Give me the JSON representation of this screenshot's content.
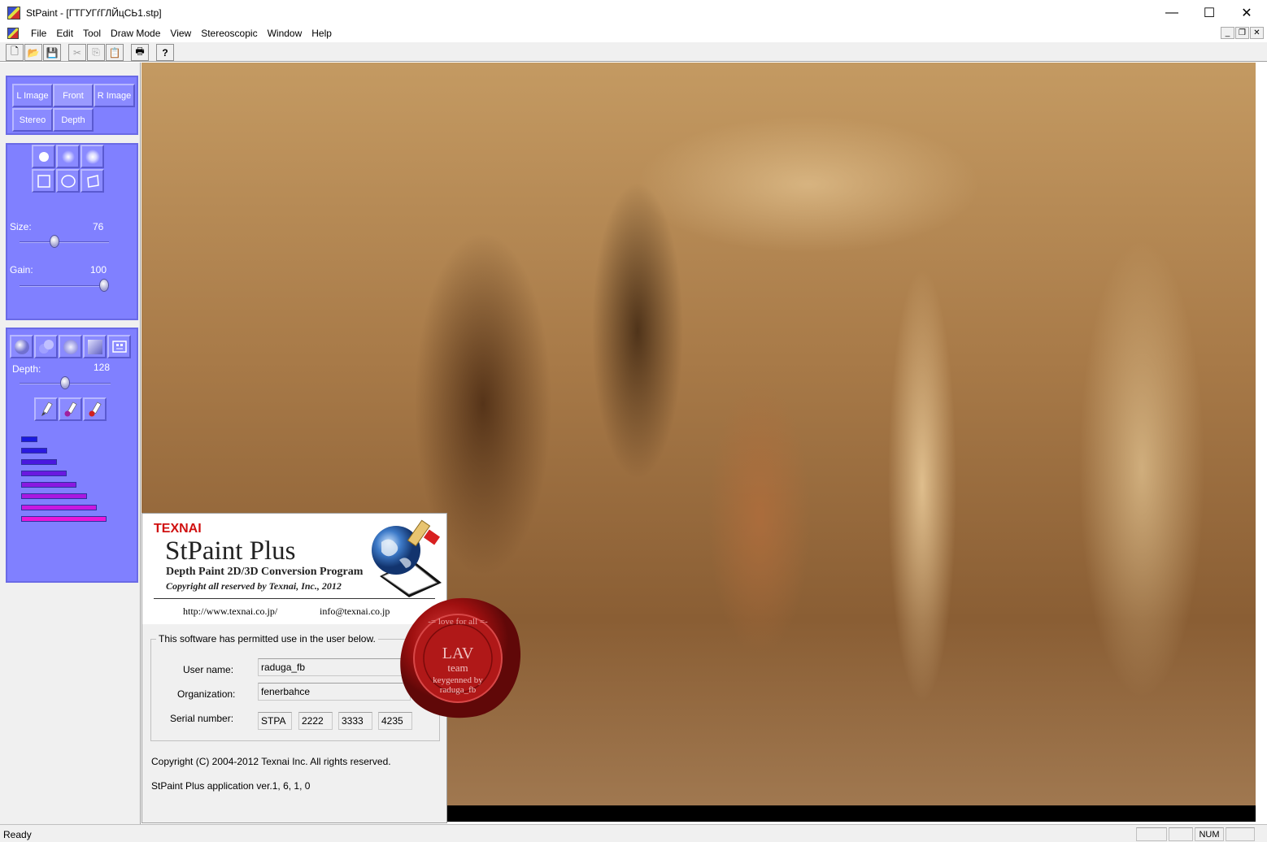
{
  "window": {
    "title": "StPaint - [ГТГУГѓГЛЙцСЬ1.stp]",
    "minimize": "—",
    "maximize": "☐",
    "close": "✕"
  },
  "menu": {
    "items": [
      "File",
      "Edit",
      "Tool",
      "Draw Mode",
      "View",
      "Stereoscopic",
      "Window",
      "Help"
    ],
    "mdi_minimize": "_",
    "mdi_restore": "❐",
    "mdi_close": "✕"
  },
  "toolbar": {
    "new": "🗋",
    "open": "📂",
    "save": "💾",
    "cut": "✂",
    "copy": "⎘",
    "paste": "📋",
    "print": "🖶",
    "help": "?"
  },
  "view_panel": {
    "buttons": [
      "L Image",
      "Front",
      "R Image",
      "Stereo",
      "Depth"
    ],
    "active": "Front"
  },
  "brush_panel": {
    "size_label": "Size:",
    "size_value": "76",
    "size_fraction": 0.38,
    "gain_label": "Gain:",
    "gain_value": "100",
    "gain_fraction": 1.0
  },
  "depth_panel": {
    "depth_label": "Depth:",
    "depth_value": "128",
    "depth_fraction": 0.5,
    "distribution_bars": [
      {
        "fraction": 0.16,
        "color": "#1a1ae0"
      },
      {
        "fraction": 0.26,
        "color": "#2a1ae0"
      },
      {
        "fraction": 0.36,
        "color": "#4a18e0"
      },
      {
        "fraction": 0.46,
        "color": "#6a18e0"
      },
      {
        "fraction": 0.56,
        "color": "#8a18e0"
      },
      {
        "fraction": 0.66,
        "color": "#a818e0"
      },
      {
        "fraction": 0.76,
        "color": "#c818e0"
      },
      {
        "fraction": 0.86,
        "color": "#e818d8"
      }
    ]
  },
  "about": {
    "brand": "TEXNAI",
    "product": "StPaint Plus",
    "subtitle": "Depth Paint 2D/3D Conversion Program",
    "copyright_line": "Copyright all reserved by Texnai, Inc., 2012",
    "url": "http://www.texnai.co.jp/",
    "email": "info@texnai.co.jp",
    "group_title": "This software has permitted use in the user below.",
    "user_label": "User name:",
    "user_value": "raduga_fb",
    "org_label": "Organization:",
    "org_value": "fenerbahce",
    "serial_label": "Serial number:",
    "serial": [
      "STPA",
      "2222",
      "3333",
      "4235"
    ],
    "footer_copyright": "Copyright (C) 2004-2012 Texnai Inc. All rights reserved.",
    "version": "StPaint Plus application ver.1, 6, 1, 0"
  },
  "seal": {
    "line1": "LAV",
    "line2": "team",
    "line3": "keygenned by",
    "line4": "raduga_fb",
    "ring": "-= love for all =-"
  },
  "status": {
    "text": "Ready",
    "num": "NUM"
  }
}
